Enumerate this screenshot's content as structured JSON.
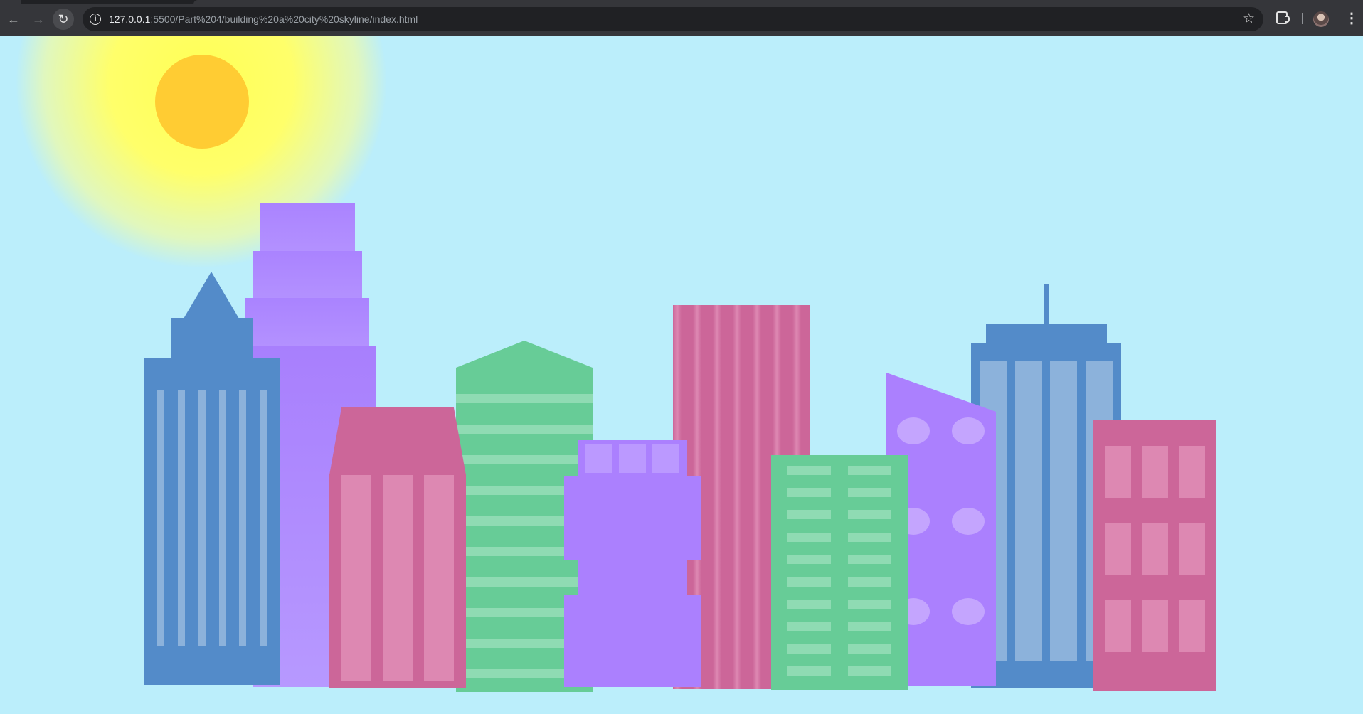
{
  "browser": {
    "back_icon": "arrow-left-icon",
    "forward_icon": "arrow-right-icon",
    "reload_icon": "reload-icon",
    "url_host": "127.0.0.1",
    "url_path": ":5500/Part%204/building%20a%20city%20skyline/index.html",
    "bookmark_icon": "star-icon",
    "extensions_icon": "puzzle-icon",
    "profile_icon": "avatar",
    "menu_icon": "kebab-menu-icon"
  },
  "scene": {
    "sky_color": "#bbeefb",
    "sun_color": "#ffcc33",
    "sun_glow_color": "#ffff66",
    "palette": {
      "blue": "#538bc9",
      "light_blue": "#8cb2db",
      "purple": "#aa80ff",
      "light_purple": "#bb99ff",
      "pink": "#cc6699",
      "light_pink": "#dd88b2",
      "green": "#67cc97",
      "light_green": "#8fdbb3"
    }
  }
}
